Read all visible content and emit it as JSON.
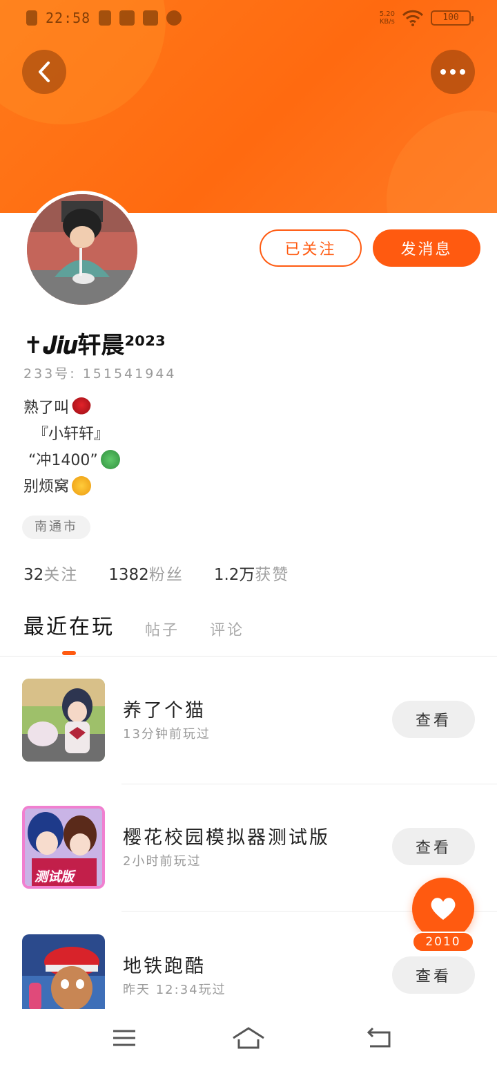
{
  "status_bar": {
    "time": "22:58",
    "net_speed": "5.20",
    "net_unit": "KB/s",
    "battery": "100"
  },
  "actions": {
    "follow_label": "已关注",
    "message_label": "发消息"
  },
  "profile": {
    "username": "✝𝑱𝒊𝒖轩晨²⁰²³",
    "uid": "233号: 151541944",
    "bio_lines": [
      "熟了叫",
      "  『小轩轩』",
      " “冲1400”",
      "别烦窝"
    ],
    "location": "南通市"
  },
  "stats": [
    {
      "num": "32",
      "label": "关注"
    },
    {
      "num": "1382",
      "label": "粉丝"
    },
    {
      "num": "1.2万",
      "label": "获赞"
    }
  ],
  "tabs": [
    "最近在玩",
    "帖子",
    "评论"
  ],
  "games": [
    {
      "name": "养了个猫",
      "time": "13分钟前玩过",
      "button": "查看"
    },
    {
      "name": "樱花校园模拟器测试版",
      "time": "2小时前玩过",
      "button": "查看"
    },
    {
      "name": "地铁跑酷",
      "time": "昨天 12:34玩过",
      "button": "查看"
    }
  ],
  "game_icon_badge": "测试版",
  "like": {
    "count": "2010"
  },
  "colors": {
    "accent": "#ff5a10",
    "header": "#ff7a1a"
  }
}
